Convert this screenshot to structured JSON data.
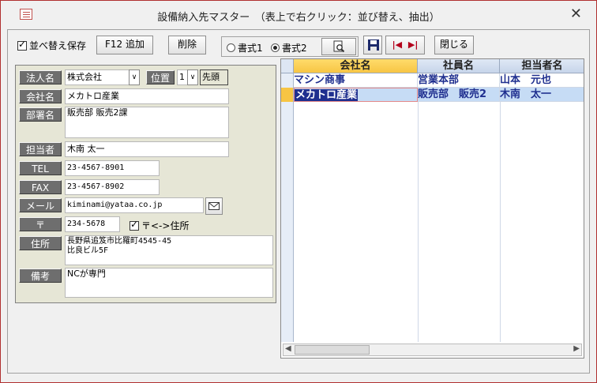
{
  "window": {
    "title": "設備納入先マスター　（表上で右クリック：並び替え、抽出）"
  },
  "toolbar": {
    "sort_save_label": "並べ替え保存",
    "sort_save_checked": true,
    "f12_add_label": "F12 追加",
    "delete_label": "削除",
    "format1_label": "書式1",
    "format2_label": "書式2",
    "format_selected": "書式2",
    "close_label": "閉じる"
  },
  "form": {
    "corp_type": {
      "label": "法人名",
      "value": "株式会社"
    },
    "position": {
      "label": "位置",
      "value": "1",
      "head": "先頭"
    },
    "company": {
      "label": "会社名",
      "value": "メカトロ産業"
    },
    "department": {
      "label": "部署名",
      "value": "販売部 販売2課"
    },
    "contact": {
      "label": "担当者",
      "value": "木南 太一"
    },
    "tel": {
      "label": "TEL",
      "value": "23-4567-8901"
    },
    "fax": {
      "label": "FAX",
      "value": "23-4567-8902"
    },
    "email": {
      "label": "メール",
      "value": "kiminami@yataa.co.jp"
    },
    "postal": {
      "label": "〒",
      "value": "234-5678",
      "swap_label": "〒<->住所",
      "swap_checked": true
    },
    "address": {
      "label": "住所",
      "value": "長野県追笈市比羅町4545-45\n比良ビル5F"
    },
    "note": {
      "label": "備考",
      "value": "NCが専門"
    }
  },
  "grid": {
    "columns": [
      "会社名",
      "社員名",
      "担当者名"
    ],
    "rows": [
      [
        "マシン商事",
        "営業本部",
        "山本　元也"
      ],
      [
        "メカトロ産業",
        "販売部　販売2",
        "木南　太一"
      ]
    ]
  },
  "colors": {
    "grid_text": "#1f2f8f",
    "header_selected": "#ffd04a",
    "selected_row": "#c6dcf5",
    "panel_bg": "#e6e6d6"
  }
}
